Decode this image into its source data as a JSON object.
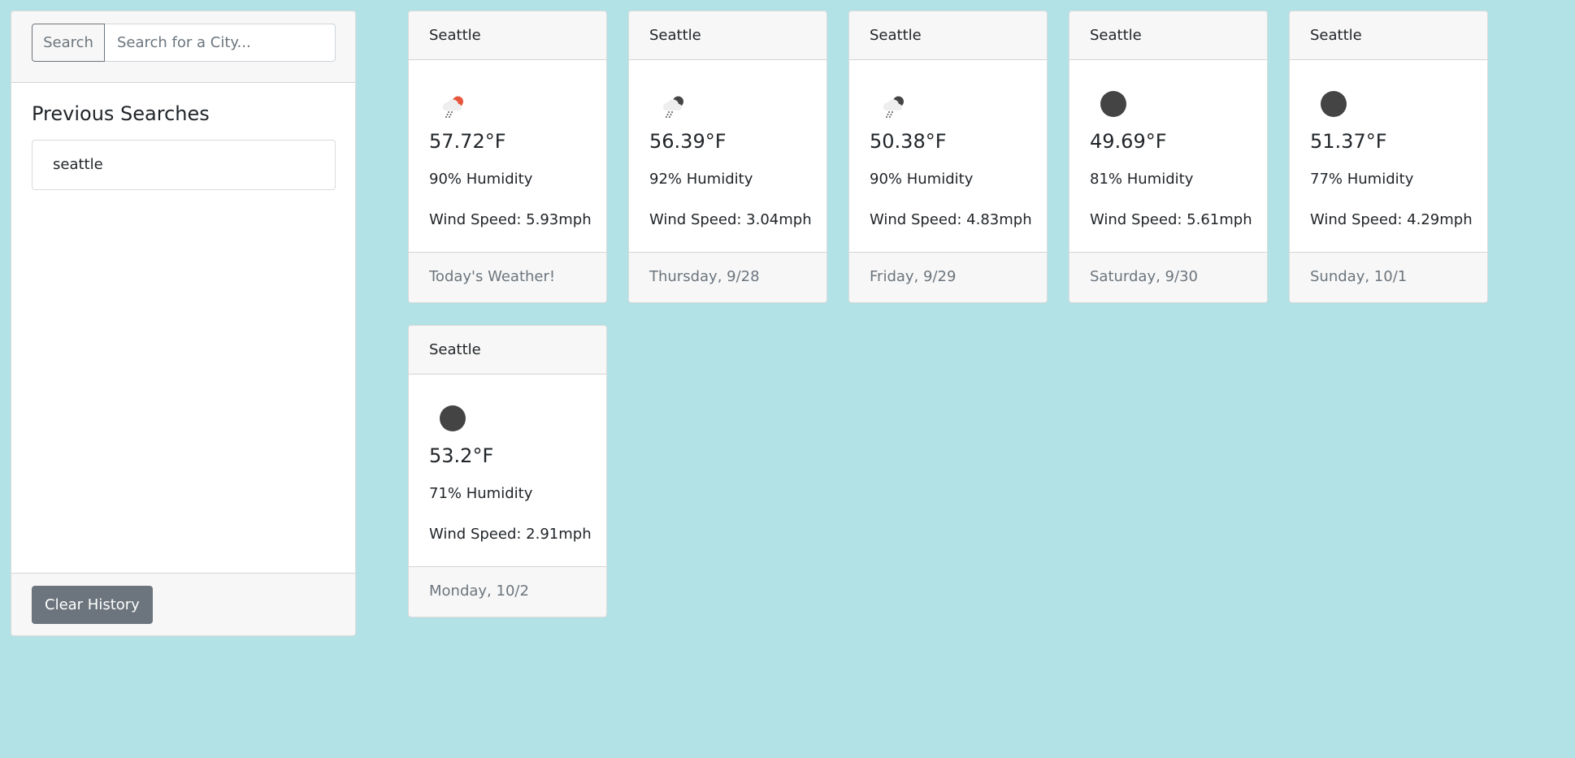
{
  "search": {
    "button_label": "Search",
    "placeholder": "Search for a City...",
    "value": ""
  },
  "sidebar": {
    "previous_title": "Previous Searches",
    "history": [
      "seattle"
    ],
    "clear_label": "Clear History"
  },
  "cards": [
    {
      "city": "Seattle",
      "icon": "rain-sun-icon",
      "temp": "57.72°F",
      "humidity": "90% Humidity",
      "wind": "Wind Speed: 5.93mph",
      "day": "Today's Weather!"
    },
    {
      "city": "Seattle",
      "icon": "rain-night-icon",
      "temp": "56.39°F",
      "humidity": "92% Humidity",
      "wind": "Wind Speed: 3.04mph",
      "day": "Thursday, 9/28"
    },
    {
      "city": "Seattle",
      "icon": "rain-night-icon",
      "temp": "50.38°F",
      "humidity": "90% Humidity",
      "wind": "Wind Speed: 4.83mph",
      "day": "Friday, 9/29"
    },
    {
      "city": "Seattle",
      "icon": "clear-night-icon",
      "temp": "49.69°F",
      "humidity": "81% Humidity",
      "wind": "Wind Speed: 5.61mph",
      "day": "Saturday, 9/30"
    },
    {
      "city": "Seattle",
      "icon": "clear-night-icon",
      "temp": "51.37°F",
      "humidity": "77% Humidity",
      "wind": "Wind Speed: 4.29mph",
      "day": "Sunday, 10/1"
    },
    {
      "city": "Seattle",
      "icon": "clear-night-icon",
      "temp": "53.2°F",
      "humidity": "71% Humidity",
      "wind": "Wind Speed: 2.91mph",
      "day": "Monday, 10/2"
    }
  ],
  "colors": {
    "background": "#b2e2e5",
    "card_header": "#f7f7f7",
    "secondary": "#6c757d",
    "sun": "#e8563e",
    "moon": "#444444"
  }
}
